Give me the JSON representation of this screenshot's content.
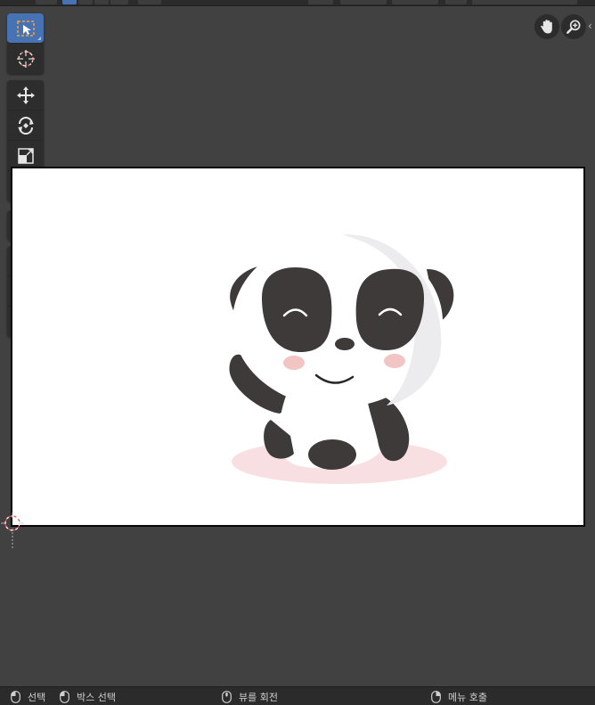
{
  "toolbar": {
    "groups": [
      [
        {
          "name": "select-box-tool-icon",
          "active": true
        },
        {
          "name": "cursor-tool-icon",
          "active": false
        }
      ],
      [
        {
          "name": "move-tool-icon"
        },
        {
          "name": "rotate-tool-icon"
        },
        {
          "name": "scale-tool-icon"
        },
        {
          "name": "transform-tool-icon"
        }
      ],
      [
        {
          "name": "annotate-tool-icon"
        }
      ],
      [
        {
          "name": "grab-tool-icon"
        },
        {
          "name": "push-tool-icon"
        },
        {
          "name": "twist-tool-icon"
        }
      ]
    ]
  },
  "navigation": {
    "pan_icon": "hand-icon",
    "zoom_icon": "zoom-icon",
    "collapse_glyph": "‹"
  },
  "canvas": {
    "image_subject": "panda-illustration",
    "background": "#ffffff"
  },
  "statusbar": {
    "select_label": "선택",
    "box_select_label": "박스 선택",
    "rotate_view_label": "뷰를 회전",
    "call_menu_label": "메뉴 호출"
  },
  "colors": {
    "accent": "#4772b3",
    "panda_dark": "#3e3a39",
    "cheek": "#f2c4c4",
    "shadow": "#f8e0e2"
  }
}
